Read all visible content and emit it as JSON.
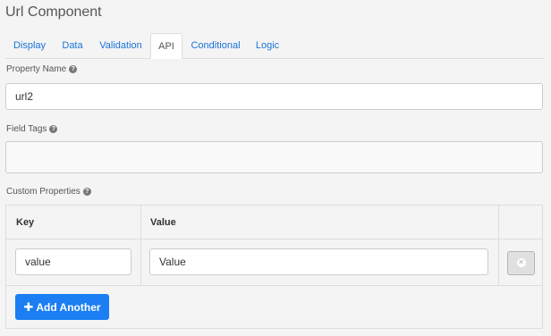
{
  "title": "Url Component",
  "tabs": [
    {
      "label": "Display"
    },
    {
      "label": "Data"
    },
    {
      "label": "Validation"
    },
    {
      "label": "API",
      "active": true
    },
    {
      "label": "Conditional"
    },
    {
      "label": "Logic"
    }
  ],
  "property_name": {
    "label": "Property Name",
    "value": "url2"
  },
  "field_tags": {
    "label": "Field Tags",
    "value": ""
  },
  "custom_properties": {
    "label": "Custom Properties",
    "columns": [
      "Key",
      "Value"
    ],
    "rows": [
      {
        "key": "value",
        "value": "Value"
      }
    ],
    "add_label": "Add Another"
  },
  "icons": {
    "help": "question-circle-icon",
    "remove": "remove-circle-icon",
    "add": "plus-icon"
  },
  "colors": {
    "accent": "#1b7ef2",
    "link": "#1a73d9"
  }
}
